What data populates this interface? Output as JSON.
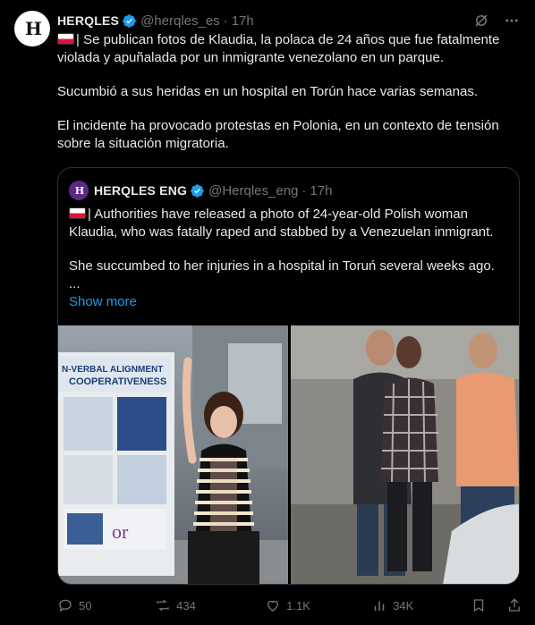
{
  "author": {
    "name": "HERQLES",
    "handle": "@herqles_es",
    "time": "17h",
    "avatar_text": "H"
  },
  "tweet": {
    "paragraphs": [
      "| Se publican fotos de Klaudia, la polaca de 24 años que fue fatalmente violada y apuñalada por un inmigrante venezolano en un parque.",
      "Sucumbió a sus heridas en un hospital en Torún hace varias semanas.",
      "El incidente ha provocado protestas en Polonia, en un contexto de tensión sobre la situación migratoria."
    ]
  },
  "quoted": {
    "name": "HERQLES ENG",
    "handle": "@Herqles_eng",
    "time": "17h",
    "avatar_text": "H",
    "paragraphs": [
      "| Authorities have released a photo of 24-year-old Polish woman Klaudia, who was fatally raped and stabbed by a Venezuelan inmigrant.",
      "She succumbed to her injuries in a hospital in Toruń several weeks ago."
    ],
    "ellipsis": "...",
    "show_more": "Show more",
    "poster": {
      "line1": "N-VERBAL ALIGNMENT",
      "line2": "COOPERATIVENESS"
    }
  },
  "actions": {
    "replies": "50",
    "reposts": "434",
    "likes": "1.1K",
    "views": "34K"
  },
  "colors": {
    "accent": "#1d9bf0",
    "muted": "#71767b",
    "text": "#e7e9ea",
    "border": "#2f3336"
  }
}
